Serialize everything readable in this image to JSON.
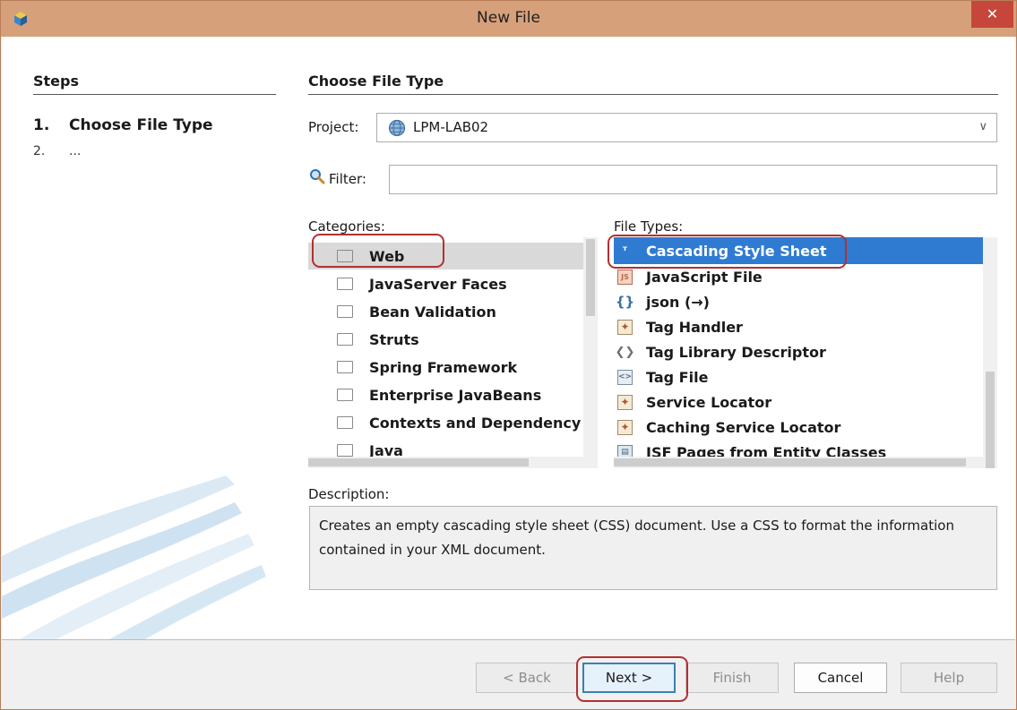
{
  "window": {
    "title": "New File",
    "close_label": "✕"
  },
  "steps": {
    "heading": "Steps",
    "items": [
      {
        "num": "1.",
        "label": "Choose File Type"
      },
      {
        "num": "2.",
        "label": "..."
      }
    ]
  },
  "main": {
    "heading": "Choose File Type",
    "project_label": "Project:",
    "project_value": "LPM-LAB02",
    "filter_label": "Filter:",
    "filter_value": "",
    "categories_label": "Categories:",
    "categories": [
      "Web",
      "JavaServer Faces",
      "Bean Validation",
      "Struts",
      "Spring Framework",
      "Enterprise JavaBeans",
      "Contexts and Dependency",
      "Java"
    ],
    "selected_category": "Web",
    "file_types_label": "File Types:",
    "file_types": [
      {
        "label": "Cascading Style Sheet",
        "icon": "css-icon"
      },
      {
        "label": "JavaScript File",
        "icon": "javascript-file-icon"
      },
      {
        "label": "json (→)",
        "icon": "json-icon"
      },
      {
        "label": "Tag Handler",
        "icon": "tag-handler-icon"
      },
      {
        "label": "Tag Library Descriptor",
        "icon": "tag-library-icon"
      },
      {
        "label": "Tag File",
        "icon": "tag-file-icon"
      },
      {
        "label": "Service Locator",
        "icon": "service-locator-icon"
      },
      {
        "label": "Caching Service Locator",
        "icon": "caching-service-locator-icon"
      },
      {
        "label": "JSF Pages from Entity Classes",
        "icon": "jsf-pages-icon"
      }
    ],
    "selected_file_type": "Cascading Style Sheet",
    "description_label": "Description:",
    "description": "Creates an empty cascading style sheet (CSS) document. Use a CSS to format the information contained in your XML document."
  },
  "buttons": {
    "back": "< Back",
    "next": "Next >",
    "finish": "Finish",
    "cancel": "Cancel",
    "help": "Help"
  },
  "colors": {
    "titlebar": "#d6a07a",
    "close": "#c7463b",
    "selection": "#2f7bd2",
    "annotation": "#b33030"
  }
}
